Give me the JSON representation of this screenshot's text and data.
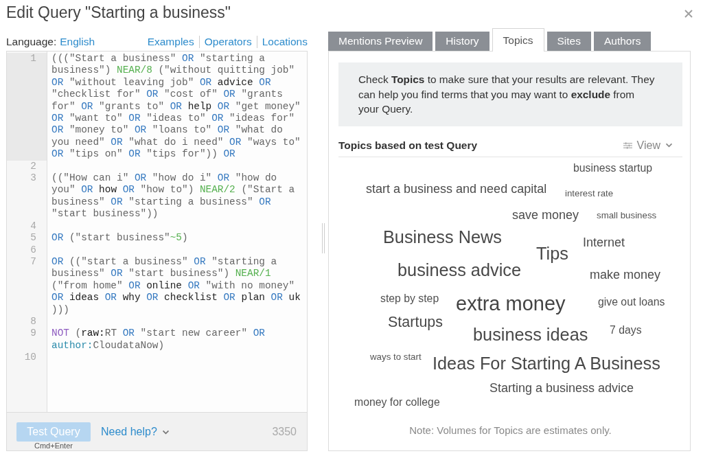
{
  "dialog": {
    "title": "Edit Query \"Starting a business\""
  },
  "query_editor": {
    "language_label": "Language:",
    "language": "English",
    "help_links": [
      "Examples",
      "Operators",
      "Locations"
    ],
    "lines": [
      {
        "number": "1",
        "active": true,
        "tokens": [
          {
            "kind": "string",
            "text": "(((\"Start a business\" "
          },
          {
            "kind": "operator",
            "text": "OR"
          },
          {
            "kind": "string",
            "text": " \"starting a business\") "
          },
          {
            "kind": "proximity",
            "text": "NEAR/8"
          },
          {
            "kind": "string",
            "text": " (\"without quitting job\" "
          },
          {
            "kind": "operator",
            "text": "OR"
          },
          {
            "kind": "string",
            "text": " \"without leaving job\" "
          },
          {
            "kind": "operator",
            "text": "OR"
          },
          {
            "kind": "term",
            "text": " advice "
          },
          {
            "kind": "operator",
            "text": "OR"
          },
          {
            "kind": "string",
            "text": " \"checklist for\" "
          },
          {
            "kind": "operator",
            "text": "OR"
          },
          {
            "kind": "string",
            "text": " \"cost of\" "
          },
          {
            "kind": "operator",
            "text": "OR"
          },
          {
            "kind": "string",
            "text": " \"grants for\" "
          },
          {
            "kind": "operator",
            "text": "OR"
          },
          {
            "kind": "string",
            "text": " \"grants to\" "
          },
          {
            "kind": "operator",
            "text": "OR"
          },
          {
            "kind": "term",
            "text": " help "
          },
          {
            "kind": "operator",
            "text": "OR"
          },
          {
            "kind": "string",
            "text": " \"get money\" "
          },
          {
            "kind": "operator",
            "text": "OR"
          },
          {
            "kind": "string",
            "text": " \"want to\" "
          },
          {
            "kind": "operator",
            "text": "OR"
          },
          {
            "kind": "string",
            "text": " \"ideas to\" "
          },
          {
            "kind": "operator",
            "text": "OR"
          },
          {
            "kind": "string",
            "text": " \"ideas for\" "
          },
          {
            "kind": "operator",
            "text": "OR"
          },
          {
            "kind": "string",
            "text": " \"money to\" "
          },
          {
            "kind": "operator",
            "text": "OR"
          },
          {
            "kind": "string",
            "text": " \"loans to\" "
          },
          {
            "kind": "operator",
            "text": "OR"
          },
          {
            "kind": "string",
            "text": " \"what do you need\" "
          },
          {
            "kind": "operator",
            "text": "OR"
          },
          {
            "kind": "string",
            "text": " \"what do i need\" "
          },
          {
            "kind": "operator",
            "text": "OR"
          },
          {
            "kind": "string",
            "text": " \"ways to\" "
          },
          {
            "kind": "operator",
            "text": "OR"
          },
          {
            "kind": "string",
            "text": " \"tips on\" "
          },
          {
            "kind": "operator",
            "text": "OR"
          },
          {
            "kind": "string",
            "text": " \"tips for\")) "
          },
          {
            "kind": "operator",
            "text": "OR"
          }
        ]
      },
      {
        "number": "2",
        "active": false
      },
      {
        "number": "3",
        "active": false,
        "tokens": [
          {
            "kind": "string",
            "text": "((\"How can i\" "
          },
          {
            "kind": "operator",
            "text": "OR"
          },
          {
            "kind": "string",
            "text": " \"how do i\" "
          },
          {
            "kind": "operator",
            "text": "OR"
          },
          {
            "kind": "string",
            "text": " \"how do you\" "
          },
          {
            "kind": "operator",
            "text": "OR"
          },
          {
            "kind": "term",
            "text": " how "
          },
          {
            "kind": "operator",
            "text": "OR"
          },
          {
            "kind": "string",
            "text": " \"how to\") "
          },
          {
            "kind": "proximity",
            "text": "NEAR/2"
          },
          {
            "kind": "string",
            "text": " (\"Start a business\" "
          },
          {
            "kind": "operator",
            "text": "OR"
          },
          {
            "kind": "string",
            "text": " \"starting a business\" "
          },
          {
            "kind": "operator",
            "text": "OR"
          },
          {
            "kind": "string",
            "text": " \"start business\"))"
          }
        ]
      },
      {
        "number": "4",
        "active": false
      },
      {
        "number": "5",
        "active": false,
        "tokens": [
          {
            "kind": "operator",
            "text": "OR"
          },
          {
            "kind": "string",
            "text": " (\"start business\""
          },
          {
            "kind": "proximity",
            "text": "~5"
          },
          {
            "kind": "string",
            "text": ")"
          }
        ]
      },
      {
        "number": "6",
        "active": false
      },
      {
        "number": "7",
        "active": false,
        "tokens": [
          {
            "kind": "operator",
            "text": "OR"
          },
          {
            "kind": "string",
            "text": " ((\"start a business\" "
          },
          {
            "kind": "operator",
            "text": "OR"
          },
          {
            "kind": "string",
            "text": " \"starting a business\" "
          },
          {
            "kind": "operator",
            "text": "OR"
          },
          {
            "kind": "string",
            "text": " \"start business\") "
          },
          {
            "kind": "proximity",
            "text": "NEAR/1"
          },
          {
            "kind": "string",
            "text": " (\"from home\" "
          },
          {
            "kind": "operator",
            "text": "OR"
          },
          {
            "kind": "term",
            "text": " online "
          },
          {
            "kind": "operator",
            "text": "OR"
          },
          {
            "kind": "string",
            "text": " \"with no money\" "
          },
          {
            "kind": "operator",
            "text": "OR"
          },
          {
            "kind": "term",
            "text": " ideas "
          },
          {
            "kind": "operator",
            "text": "OR"
          },
          {
            "kind": "term",
            "text": " why "
          },
          {
            "kind": "operator",
            "text": "OR"
          },
          {
            "kind": "term",
            "text": " checklist "
          },
          {
            "kind": "operator",
            "text": "OR"
          },
          {
            "kind": "term",
            "text": " plan "
          },
          {
            "kind": "operator",
            "text": "OR"
          },
          {
            "kind": "term",
            "text": " uk "
          },
          {
            "kind": "string",
            "text": ")))"
          }
        ]
      },
      {
        "number": "8",
        "active": false
      },
      {
        "number": "9",
        "active": false,
        "tokens": [
          {
            "kind": "negation",
            "text": "NOT"
          },
          {
            "kind": "string",
            "text": " ("
          },
          {
            "kind": "field",
            "text": "raw:"
          },
          {
            "kind": "string",
            "text": "RT "
          },
          {
            "kind": "operator",
            "text": "OR"
          },
          {
            "kind": "string",
            "text": " \"start new career\" "
          },
          {
            "kind": "operator",
            "text": "OR"
          },
          {
            "kind": "author-field",
            "text": " author:"
          },
          {
            "kind": "string",
            "text": "CloudataNow)"
          }
        ]
      },
      {
        "number": "10",
        "active": false
      }
    ],
    "test_button": {
      "label": "Test Query",
      "disabled": true
    },
    "shortcut": "Cmd+Enter",
    "help_toggle": "Need help?",
    "character_count": "3350"
  },
  "preview": {
    "tabs": [
      {
        "label": "Mentions Preview",
        "selected": false
      },
      {
        "label": "History",
        "selected": false
      },
      {
        "label": "Topics",
        "selected": true
      },
      {
        "label": "Sites",
        "selected": false
      },
      {
        "label": "Authors",
        "selected": false
      }
    ],
    "info": "Check **Topics** to make sure that your results are relevant. They can help you find terms that you may want to **exclude** from your Query.",
    "topics_heading": "Topics based on test Query",
    "view_menu": "View",
    "topics": [
      {
        "text": "business startup",
        "kind": "small"
      },
      {
        "text": "start a business and need capital",
        "kind": "medium"
      },
      {
        "text": "interest rate",
        "kind": "tiny"
      },
      {
        "text": "save money",
        "kind": "medium"
      },
      {
        "text": "small business",
        "kind": "tiny"
      },
      {
        "text": "Business News",
        "kind": "xlarge"
      },
      {
        "text": "Tips",
        "kind": "xlarge"
      },
      {
        "text": "Internet",
        "kind": "medium"
      },
      {
        "text": "business advice",
        "kind": "xlarge"
      },
      {
        "text": "make money",
        "kind": "medium"
      },
      {
        "text": "step by step",
        "kind": "small"
      },
      {
        "text": "extra money",
        "kind": "xxlarge"
      },
      {
        "text": "give out loans",
        "kind": "small"
      },
      {
        "text": "Startups",
        "kind": "large"
      },
      {
        "text": "business ideas",
        "kind": "xlarge"
      },
      {
        "text": "7 days",
        "kind": "small"
      },
      {
        "text": "ways to start",
        "kind": "tiny"
      },
      {
        "text": "Ideas For Starting A Business",
        "kind": "xlarge"
      },
      {
        "text": "Starting a business advice",
        "kind": "medium"
      },
      {
        "text": "money for college",
        "kind": "small"
      }
    ],
    "note": "Note: Volumes for Topics are estimates only."
  }
}
